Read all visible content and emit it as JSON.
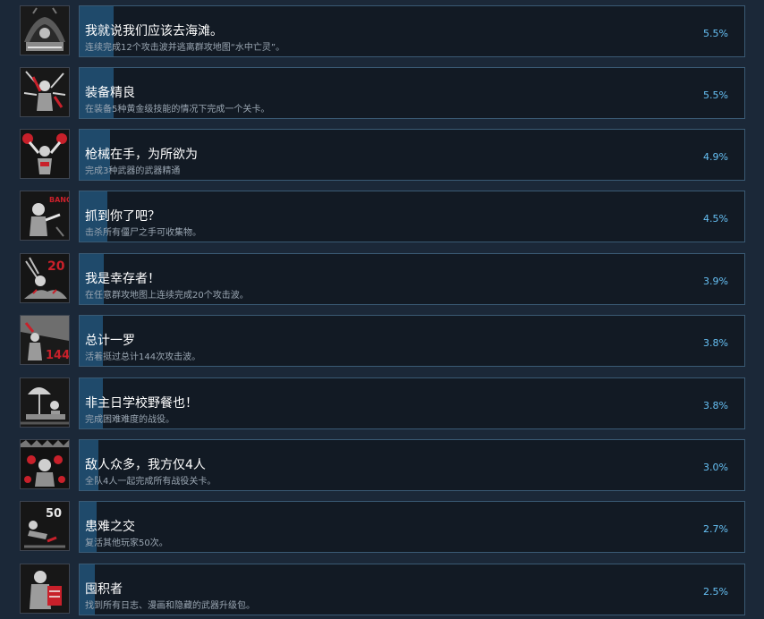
{
  "achievements": [
    {
      "title": "我就说我们应该去海滩。",
      "desc": "连续完成12个攻击波并逃离群攻地图“水中亡灵”。",
      "percent": "5.5%",
      "fraction": 0.055,
      "icon": "beach-zombie-icon"
    },
    {
      "title": "装备精良",
      "desc": "在装备5种黄金级技能的情况下完成一个关卡。",
      "percent": "5.5%",
      "fraction": 0.055,
      "icon": "equipped-survivor-icon"
    },
    {
      "title": "枪械在手，为所欲为",
      "desc": "完成3种武器的武器精通",
      "percent": "4.9%",
      "fraction": 0.049,
      "icon": "dual-guns-icon"
    },
    {
      "title": "抓到你了吧？",
      "desc": "击杀所有僵尸之手可收集物。",
      "percent": "4.5%",
      "fraction": 0.045,
      "icon": "bang-zombie-icon"
    },
    {
      "title": "我是幸存者！",
      "desc": "在任意群攻地图上连续完成20个攻击波。",
      "percent": "3.9%",
      "fraction": 0.039,
      "icon": "wave-20-icon"
    },
    {
      "title": "总计一罗",
      "desc": "活着挺过总计144次攻击波。",
      "percent": "3.8%",
      "fraction": 0.038,
      "icon": "wave-144-icon"
    },
    {
      "title": "非主日学校野餐也！",
      "desc": "完成困难难度的战役。",
      "percent": "3.8%",
      "fraction": 0.038,
      "icon": "picnic-icon"
    },
    {
      "title": "敌人众多，我方仅4人",
      "desc": "全队4人一起完成所有战役关卡。",
      "percent": "3.0%",
      "fraction": 0.03,
      "icon": "horde-eyes-icon"
    },
    {
      "title": "患难之交",
      "desc": "复活其他玩家50次。",
      "percent": "2.7%",
      "fraction": 0.027,
      "icon": "revive-50-icon"
    },
    {
      "title": "囤积者",
      "desc": "找到所有日志、漫画和隐藏的武器升级包。",
      "percent": "2.5%",
      "fraction": 0.025,
      "icon": "hoarder-icon"
    }
  ],
  "icon_texts": {
    "bang": "BANG!",
    "twenty": "20",
    "one_forty_four": "144",
    "fifty": "50"
  },
  "colors": {
    "background": "#1b2838",
    "bar_fill": "#1f4a6b",
    "bar_border": "#3a5a74",
    "percent_text": "#66c0f4",
    "accent_red": "#c8202a"
  }
}
